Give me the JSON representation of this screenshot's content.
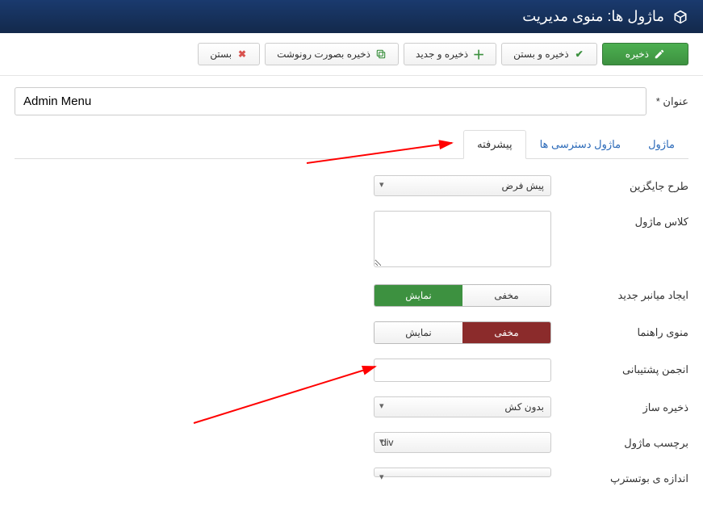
{
  "header": {
    "title": "ماژول ها: منوی مدیریت"
  },
  "toolbar": {
    "save": "ذخیره",
    "save_close": "ذخیره و بستن",
    "save_new": "ذخیره و جدید",
    "save_copy": "ذخیره بصورت رونوشت",
    "close": "بستن"
  },
  "title_field": {
    "label": "عنوان *",
    "value": "Admin Menu"
  },
  "tabs": {
    "module": "ماژول",
    "access": "ماژول دسترسی ها",
    "advanced": "پیشرفته"
  },
  "fields": {
    "alt_layout": {
      "label": "طرح جایگزین",
      "value": "پیش فرض"
    },
    "module_class": {
      "label": "کلاس ماژول",
      "value": ""
    },
    "new_shortcut": {
      "label": "ایجاد میانبر جدید",
      "hide": "مخفی",
      "show": "نمایش"
    },
    "help_menu": {
      "label": "منوی راهنما",
      "hide": "مخفی",
      "show": "نمایش"
    },
    "support_forum": {
      "label": "انجمن پشتیبانی",
      "value": ""
    },
    "cache": {
      "label": "ذخیره ساز",
      "value": "بدون کش"
    },
    "module_tag": {
      "label": "برچسب ماژول",
      "value": "div"
    },
    "bootstrap_size": {
      "label": "اندازه ی بوتسترپ",
      "value": ""
    }
  }
}
